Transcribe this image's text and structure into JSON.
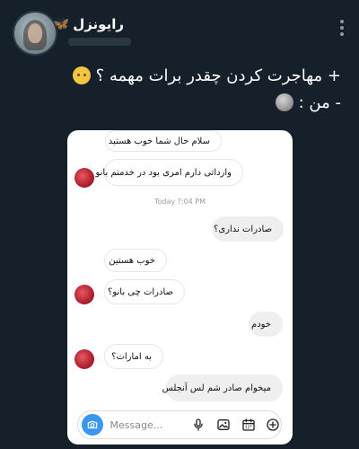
{
  "header": {
    "name": "رایونزل",
    "name_decoration": "🦋"
  },
  "tweet": {
    "line1": "+ مهاجرت کردن چقدر برات مهمه ؟",
    "line2": "- من :"
  },
  "chat": {
    "messages": [
      {
        "text": "سلام حال شما خوب هستید",
        "sender": "them"
      },
      {
        "text": "وارداتی دارم امری بود در خدمتم بانو",
        "sender": "them"
      },
      {
        "text": "صادرات نداری؟",
        "sender": "me"
      },
      {
        "text": "خوب هستین",
        "sender": "them"
      },
      {
        "text": "صادرات چی بانو؟",
        "sender": "them"
      },
      {
        "text": "خودم",
        "sender": "me"
      },
      {
        "text": "به امارات؟",
        "sender": "them"
      },
      {
        "text": "میخوام صادر شم لس آنجلس",
        "sender": "me"
      }
    ],
    "timestamp": "Today ?:04 PM"
  },
  "composer": {
    "placeholder": "Message..."
  },
  "icons": {
    "more": "more-vertical-icon",
    "camera": "camera-icon",
    "mic": "microphone-icon",
    "gallery": "gallery-icon",
    "sticker": "calendar-sticker-icon",
    "add": "plus-circle-icon"
  },
  "colors": {
    "background": "#15202b",
    "camera_button": "#3a97f0"
  }
}
